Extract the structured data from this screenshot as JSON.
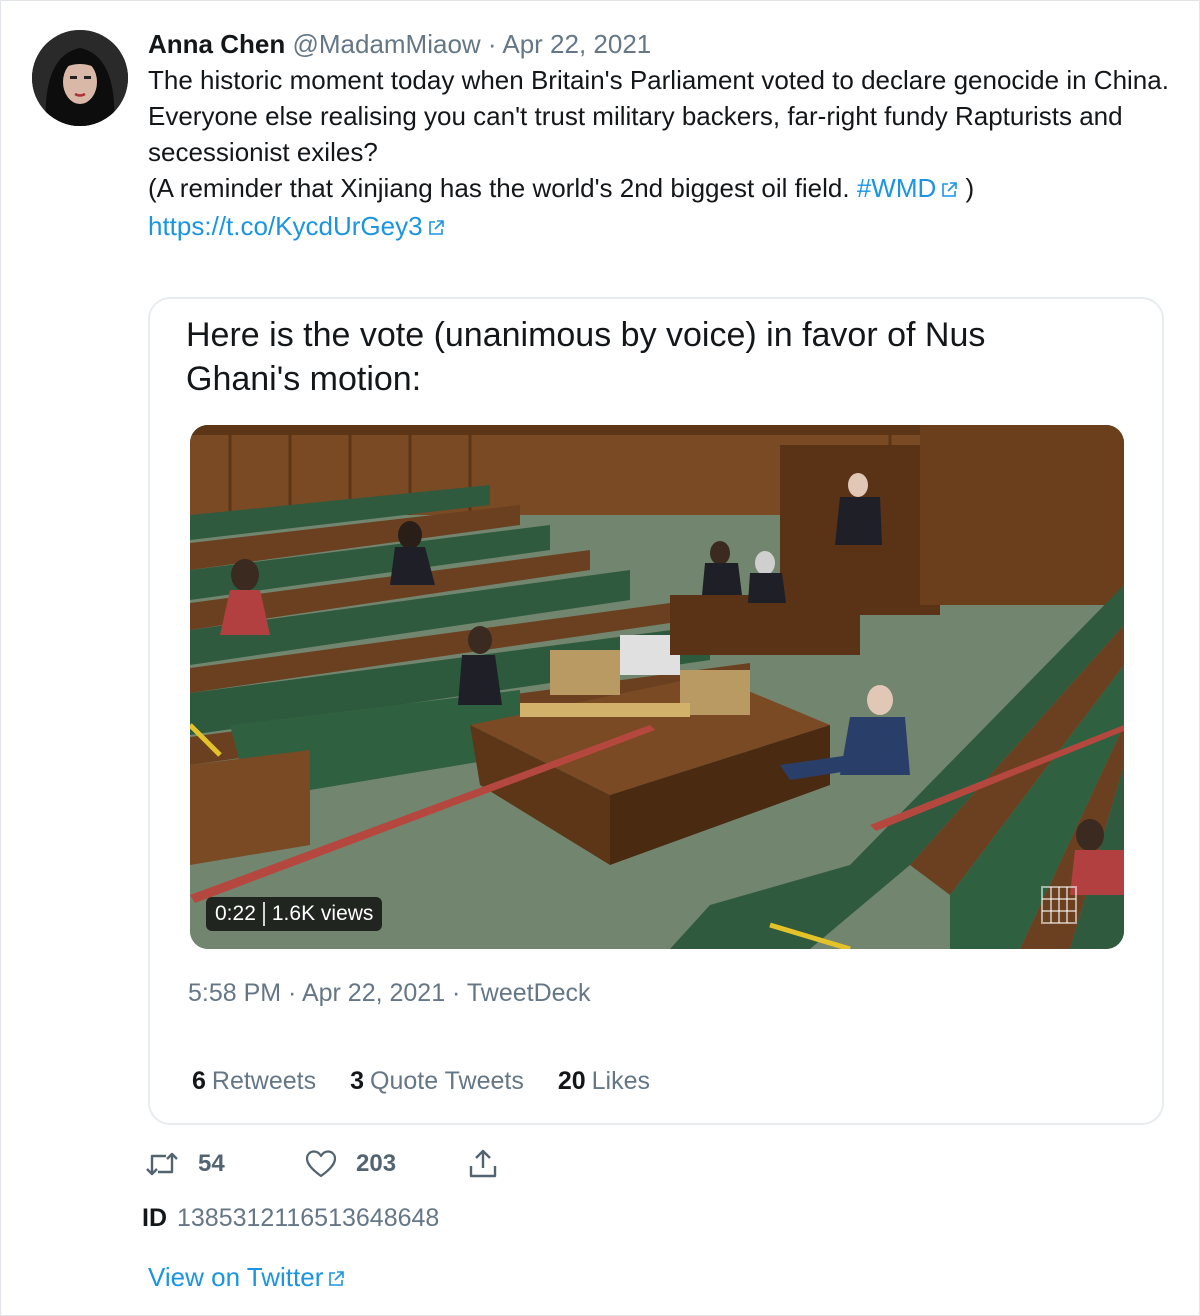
{
  "tweet": {
    "author_name": "Anna Chen",
    "handle": "@MadamMiaow",
    "separator": " · ",
    "date": "Apr 22, 2021",
    "lines": [
      "The historic moment today when Britain's Parliament voted to declare genocide in China.",
      "Everyone else realising you can't trust military backers, far-right fundy Rapturists and secessionist exiles?"
    ],
    "line3_prefix": "(A reminder that Xinjiang has the world's 2nd biggest oil field. ",
    "hashtag": "#WMD",
    "line3_suffix": " )",
    "url": "https://t.co/KycdUrGey3"
  },
  "quoted": {
    "text": "Here is the vote (unanimous by voice) in favor of Nus Ghani's motion:",
    "video": {
      "duration": "0:22",
      "views": "1.6K views"
    },
    "timestamp": "5:58 PM · Apr 22, 2021 · TweetDeck",
    "stats": {
      "retweets_count": "6",
      "retweets_label": "Retweets",
      "quotes_count": "3",
      "quotes_label": "Quote Tweets",
      "likes_count": "20",
      "likes_label": "Likes"
    }
  },
  "actions": {
    "retweets": "54",
    "likes": "203"
  },
  "id_label": "ID",
  "id_value": "1385312116513648648",
  "view_on_twitter": "View on Twitter",
  "colors": {
    "link": "#1b95e0",
    "muted": "#657786",
    "text": "#14171a",
    "border": "#e6ecf0"
  },
  "icons": [
    "external-link-icon",
    "retweet-icon",
    "heart-icon",
    "share-icon"
  ]
}
